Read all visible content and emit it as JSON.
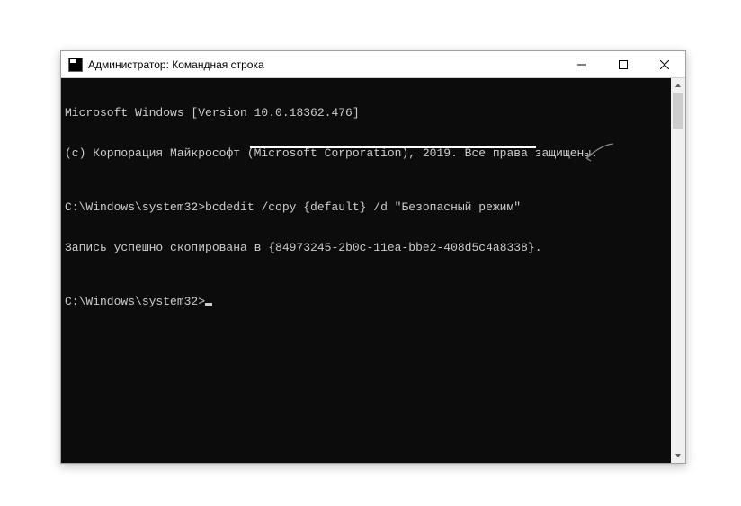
{
  "titlebar": {
    "title": "Администратор: Командная строка"
  },
  "terminal": {
    "line1": "Microsoft Windows [Version 10.0.18362.476]",
    "line2": "(c) Корпорация Майкрософт (Microsoft Corporation), 2019. Все права защищены.",
    "prompt1": "C:\\Windows\\system32>",
    "command1": "bcdedit /copy {default} /d \"Безопасный режим\"",
    "response_prefix": "Запись успешно скопирована в ",
    "response_guid": "{84973245-2b0c-11ea-bbe2-408d5c4a8338}",
    "response_suffix": ".",
    "prompt2": "C:\\Windows\\system32>"
  }
}
